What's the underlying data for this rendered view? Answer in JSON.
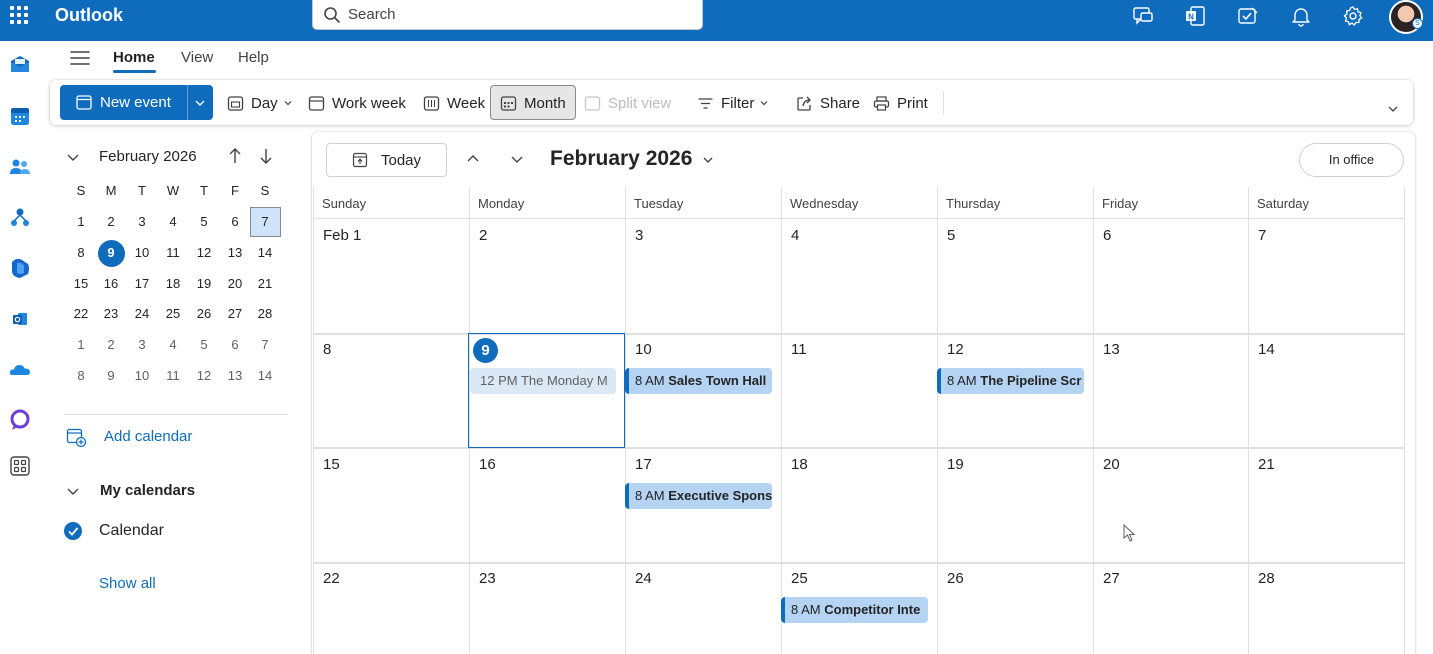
{
  "app": {
    "name": "Outlook"
  },
  "search": {
    "placeholder": "Search"
  },
  "tabs": [
    "Home",
    "View",
    "Help"
  ],
  "ribbon": {
    "new_event": "New event",
    "day": "Day",
    "work_week": "Work week",
    "week": "Week",
    "month": "Month",
    "split_view": "Split view",
    "filter": "Filter",
    "share": "Share",
    "print": "Print"
  },
  "mini_calendar": {
    "title": "February 2026",
    "weekdays": [
      "S",
      "M",
      "T",
      "W",
      "T",
      "F",
      "S"
    ],
    "weeks": [
      [
        "1",
        "2",
        "3",
        "4",
        "5",
        "6",
        "7"
      ],
      [
        "8",
        "9",
        "10",
        "11",
        "12",
        "13",
        "14"
      ],
      [
        "15",
        "16",
        "17",
        "18",
        "19",
        "20",
        "21"
      ],
      [
        "22",
        "23",
        "24",
        "25",
        "26",
        "27",
        "28"
      ],
      [
        "1",
        "2",
        "3",
        "4",
        "5",
        "6",
        "7"
      ],
      [
        "8",
        "9",
        "10",
        "11",
        "12",
        "13",
        "14"
      ]
    ]
  },
  "sidebar": {
    "add_calendar": "Add calendar",
    "my_calendars": "My calendars",
    "calendar": "Calendar",
    "show_all": "Show all"
  },
  "main": {
    "today": "Today",
    "title": "February 2026",
    "status": "In office",
    "day_names": [
      "Sunday",
      "Monday",
      "Tuesday",
      "Wednesday",
      "Thursday",
      "Friday",
      "Saturday"
    ],
    "weeks": [
      [
        "Feb 1",
        "2",
        "3",
        "4",
        "5",
        "6",
        "7"
      ],
      [
        "8",
        "9",
        "10",
        "11",
        "12",
        "13",
        "14"
      ],
      [
        "15",
        "16",
        "17",
        "18",
        "19",
        "20",
        "21"
      ],
      [
        "22",
        "23",
        "24",
        "25",
        "26",
        "27",
        "28"
      ]
    ],
    "events": [
      {
        "time": "12 PM",
        "title": "The Monday M"
      },
      {
        "time": "8 AM",
        "title": "Sales Town Hall"
      },
      {
        "time": "8 AM",
        "title": "The Pipeline Scr"
      },
      {
        "time": "8 AM",
        "title": "Executive Spons"
      },
      {
        "time": "8 AM",
        "title": "Competitor Inte"
      }
    ]
  },
  "colors": {
    "brand": "#0f6cbd",
    "event_fill": "#b5d3f2",
    "selected_day": "#cfe4fa"
  }
}
